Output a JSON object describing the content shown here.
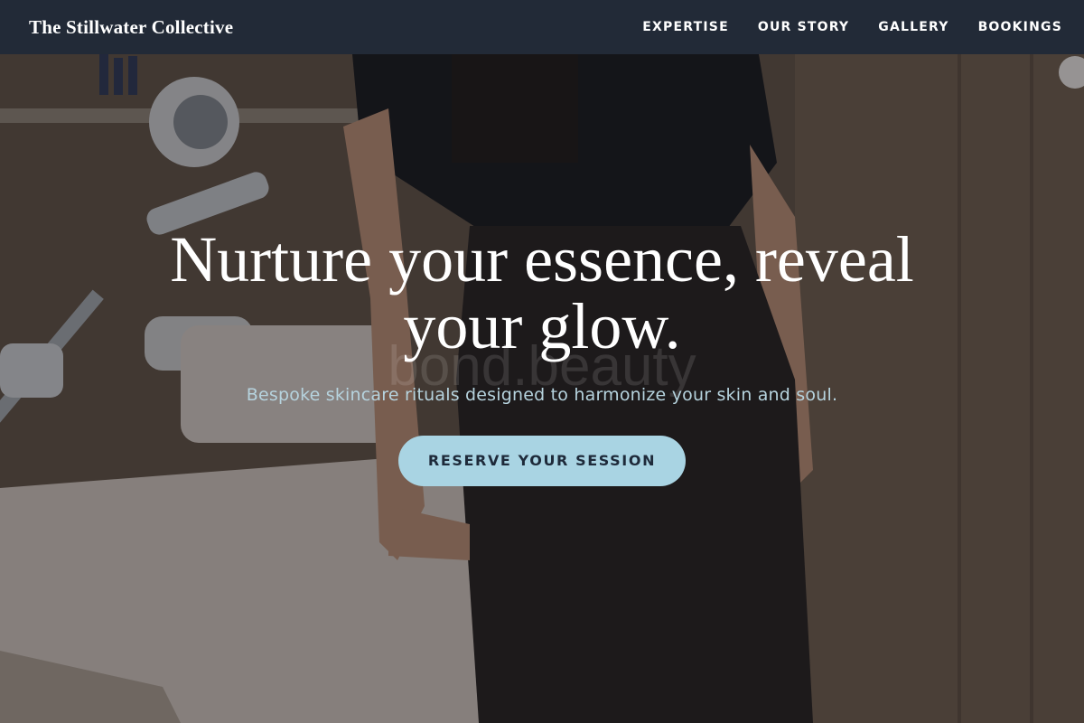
{
  "brand": {
    "name": "The Stillwater Collective"
  },
  "nav": {
    "items": [
      {
        "label": "EXPERTISE"
      },
      {
        "label": "OUR STORY"
      },
      {
        "label": "GALLERY"
      },
      {
        "label": "BOOKINGS"
      }
    ]
  },
  "hero": {
    "title": "Nurture your essence, reveal your glow.",
    "subtitle": "Bespoke skincare rituals designed to harmonize your skin and soul.",
    "cta_label": "RESERVE YOUR SESSION",
    "watermark": "bond.beauty"
  },
  "colors": {
    "navbar": "#1f2937",
    "cta_background": "#a9d4e3",
    "cta_text": "#1e2a3a",
    "subtitle": "#b6d3de"
  }
}
